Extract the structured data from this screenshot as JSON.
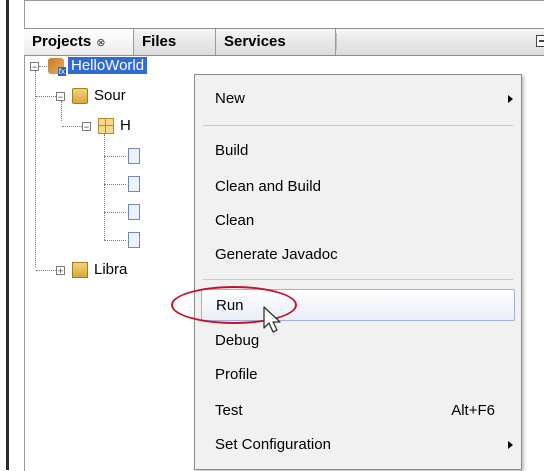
{
  "tabs": {
    "projects": "Projects",
    "projects_close": "⊗",
    "files": "Files",
    "services": "Services"
  },
  "tree": {
    "root": "HelloWorld",
    "source": "Sour",
    "package": "H",
    "libraries": "Libra"
  },
  "context_menu": {
    "new": "New",
    "build": "Build",
    "clean_and_build": "Clean and Build",
    "clean": "Clean",
    "generate_javadoc": "Generate Javadoc",
    "run": "Run",
    "debug": "Debug",
    "profile": "Profile",
    "test": "Test",
    "test_shortcut": "Alt+F6",
    "set_configuration": "Set Configuration"
  },
  "colors": {
    "selection": "#2f6bd3",
    "highlight_ellipse": "#c8102e"
  }
}
